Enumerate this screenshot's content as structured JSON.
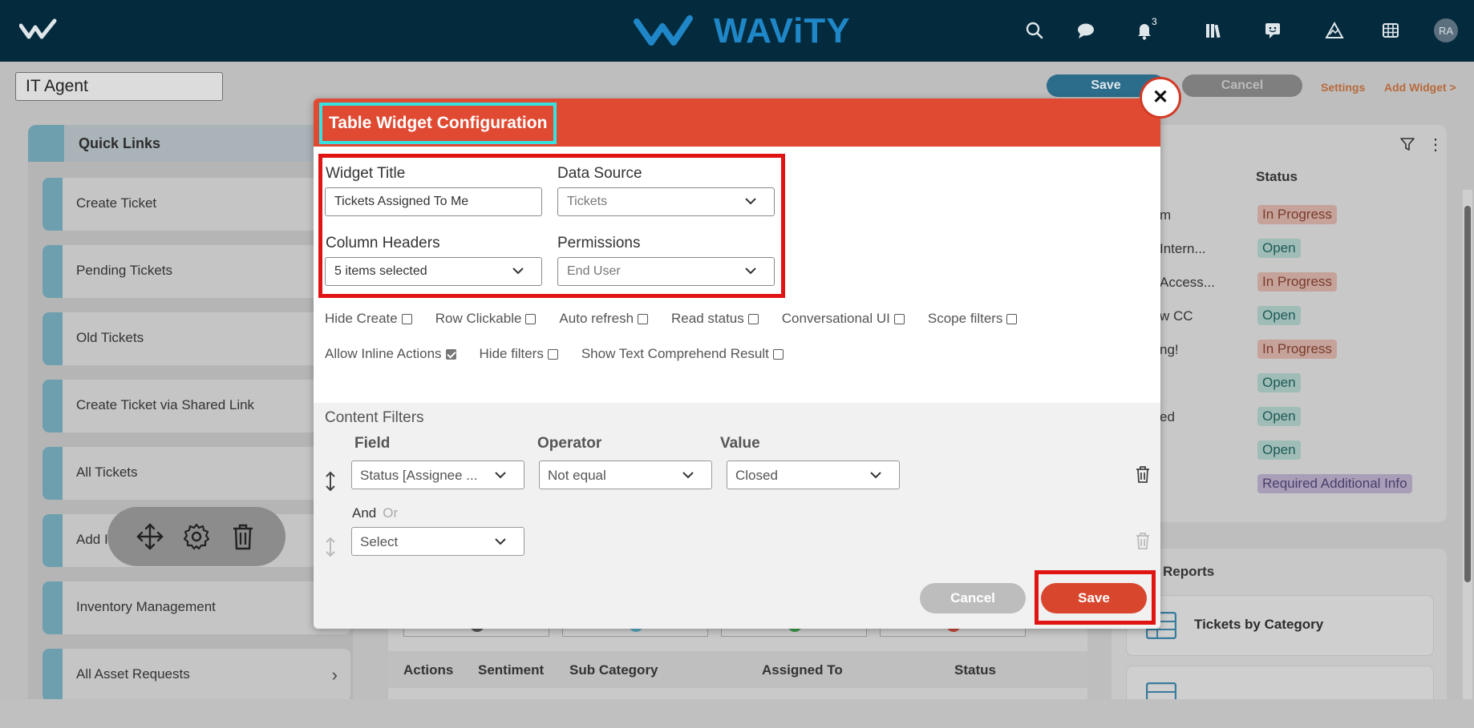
{
  "app": {
    "brand": "WAViTY",
    "notification_count": "3",
    "avatar_initials": "RA",
    "accent_color": "#e04a32",
    "topbar_color": "#042a3d"
  },
  "toolbar": {
    "dashboard_title": "IT Agent",
    "save_label": "Save",
    "cancel_label": "Cancel",
    "settings_label": "Settings",
    "add_widget_label": "Add Widget >"
  },
  "quick_links": {
    "title": "Quick Links",
    "items": [
      {
        "label": "Create Ticket"
      },
      {
        "label": "Pending Tickets"
      },
      {
        "label": "Old Tickets"
      },
      {
        "label": "Create Ticket via Shared Link"
      },
      {
        "label": "All Tickets"
      },
      {
        "label": "Add I"
      },
      {
        "label": "Inventory Management"
      },
      {
        "label": "All Asset Requests"
      }
    ]
  },
  "right_table": {
    "status_header": "Status",
    "rows": [
      {
        "title": "m",
        "status": "In Progress"
      },
      {
        "title": "Intern...",
        "status": "Open"
      },
      {
        "title": "Access...",
        "status": "In Progress"
      },
      {
        "title": "w CC",
        "status": "Open"
      },
      {
        "title": "ng!",
        "status": "In Progress"
      },
      {
        "title": "",
        "status": "Open"
      },
      {
        "title": "ed",
        "status": "Open"
      },
      {
        "title": "",
        "status": "Open"
      },
      {
        "title": "",
        "status": "Required Additional Info"
      }
    ]
  },
  "reports": {
    "title": "Reports",
    "items": [
      {
        "label": "Tickets by Category"
      }
    ]
  },
  "middle_table": {
    "headers": [
      "Actions",
      "Sentiment",
      "Sub Category",
      "Assigned To",
      "Status"
    ]
  },
  "modal": {
    "title": "Table Widget Configuration",
    "close_label": "✕",
    "widget_title_label": "Widget Title",
    "widget_title_value": "Tickets Assigned To Me",
    "data_source_label": "Data Source",
    "data_source_value": "Tickets",
    "column_headers_label": "Column Headers",
    "column_headers_value": "5 items selected",
    "permissions_label": "Permissions",
    "permissions_value": "End User",
    "checkboxes_row1": [
      {
        "label": "Hide Create",
        "checked": false
      },
      {
        "label": "Row Clickable",
        "checked": false
      },
      {
        "label": "Auto refresh",
        "checked": false
      },
      {
        "label": "Read status",
        "checked": false
      },
      {
        "label": "Conversational UI",
        "checked": false
      },
      {
        "label": "Scope filters",
        "checked": false
      }
    ],
    "checkboxes_row2": [
      {
        "label": "Allow Inline Actions",
        "checked": true
      },
      {
        "label": "Hide filters",
        "checked": false
      },
      {
        "label": "Show Text Comprehend Result",
        "checked": false
      }
    ],
    "content_filters": {
      "title": "Content Filters",
      "field_header": "Field",
      "operator_header": "Operator",
      "value_header": "Value",
      "filter1": {
        "field": "Status [Assignee ...",
        "operator": "Not equal",
        "value": "Closed"
      },
      "and_label": "And",
      "or_label": "Or",
      "filter2": {
        "field": "Select"
      }
    },
    "cancel_label": "Cancel",
    "save_label": "Save"
  }
}
